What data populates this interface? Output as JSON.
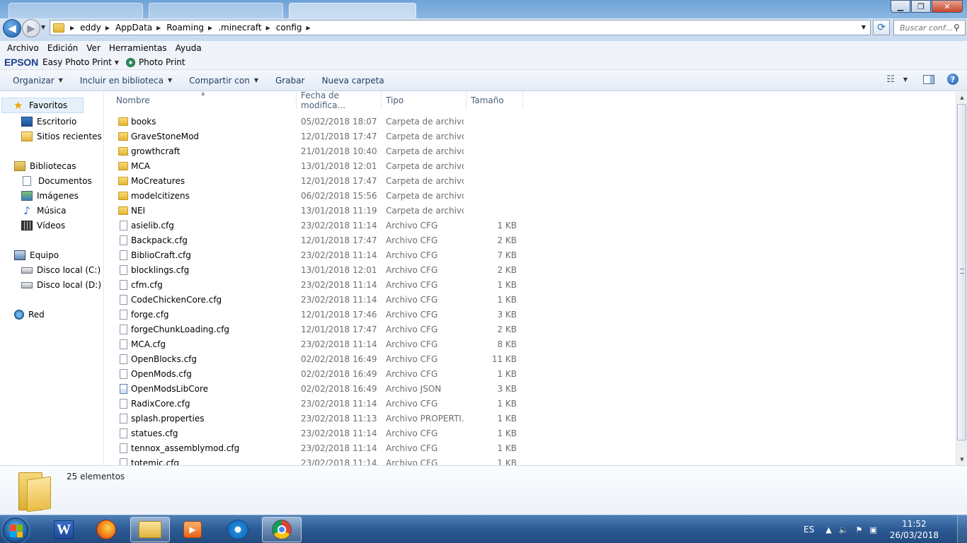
{
  "window": {
    "minimize_icon": "minimize-icon",
    "maximize_icon": "maximize-icon",
    "close_icon": "close-icon"
  },
  "address": {
    "breadcrumbs": [
      "eddy",
      "AppData",
      "Roaming",
      ".minecraft",
      "config"
    ],
    "search_placeholder": "Buscar conf..."
  },
  "menu": [
    "Archivo",
    "Edición",
    "Ver",
    "Herramientas",
    "Ayuda"
  ],
  "epson": {
    "logo": "EPSON",
    "easy_photo_print": "Easy Photo Print",
    "photo_print": "Photo Print"
  },
  "commands": {
    "organize": "Organizar",
    "include_library": "Incluir en biblioteca",
    "share_with": "Compartir con",
    "burn": "Grabar",
    "new_folder": "Nueva carpeta"
  },
  "nav": {
    "favorites": "Favoritos",
    "desktop": "Escritorio",
    "recent": "Sitios recientes",
    "libraries": "Bibliotecas",
    "documents": "Documentos",
    "images": "Imágenes",
    "music": "Música",
    "videos": "Vídeos",
    "computer": "Equipo",
    "drive_c": "Disco local (C:)",
    "drive_d": "Disco local (D:)",
    "network": "Red"
  },
  "columns": {
    "name": "Nombre",
    "date": "Fecha de modifica...",
    "type": "Tipo",
    "size": "Tamaño"
  },
  "files": [
    {
      "name": "books",
      "date": "05/02/2018 18:07",
      "type": "Carpeta de archivos",
      "size": "",
      "kind": "folder"
    },
    {
      "name": "GraveStoneMod",
      "date": "12/01/2018 17:47",
      "type": "Carpeta de archivos",
      "size": "",
      "kind": "folder"
    },
    {
      "name": "growthcraft",
      "date": "21/01/2018 10:40",
      "type": "Carpeta de archivos",
      "size": "",
      "kind": "folder"
    },
    {
      "name": "MCA",
      "date": "13/01/2018 12:01",
      "type": "Carpeta de archivos",
      "size": "",
      "kind": "folder"
    },
    {
      "name": "MoCreatures",
      "date": "12/01/2018 17:47",
      "type": "Carpeta de archivos",
      "size": "",
      "kind": "folder"
    },
    {
      "name": "modelcitizens",
      "date": "06/02/2018 15:56",
      "type": "Carpeta de archivos",
      "size": "",
      "kind": "folder"
    },
    {
      "name": "NEI",
      "date": "13/01/2018 11:19",
      "type": "Carpeta de archivos",
      "size": "",
      "kind": "folder"
    },
    {
      "name": "asielib.cfg",
      "date": "23/02/2018 11:14",
      "type": "Archivo CFG",
      "size": "1 KB",
      "kind": "file"
    },
    {
      "name": "Backpack.cfg",
      "date": "12/01/2018 17:47",
      "type": "Archivo CFG",
      "size": "2 KB",
      "kind": "file"
    },
    {
      "name": "BiblioCraft.cfg",
      "date": "23/02/2018 11:14",
      "type": "Archivo CFG",
      "size": "7 KB",
      "kind": "file"
    },
    {
      "name": "blocklings.cfg",
      "date": "13/01/2018 12:01",
      "type": "Archivo CFG",
      "size": "2 KB",
      "kind": "file"
    },
    {
      "name": "cfm.cfg",
      "date": "23/02/2018 11:14",
      "type": "Archivo CFG",
      "size": "1 KB",
      "kind": "file"
    },
    {
      "name": "CodeChickenCore.cfg",
      "date": "23/02/2018 11:14",
      "type": "Archivo CFG",
      "size": "1 KB",
      "kind": "file"
    },
    {
      "name": "forge.cfg",
      "date": "12/01/2018 17:46",
      "type": "Archivo CFG",
      "size": "3 KB",
      "kind": "file"
    },
    {
      "name": "forgeChunkLoading.cfg",
      "date": "12/01/2018 17:47",
      "type": "Archivo CFG",
      "size": "2 KB",
      "kind": "file"
    },
    {
      "name": "MCA.cfg",
      "date": "23/02/2018 11:14",
      "type": "Archivo CFG",
      "size": "8 KB",
      "kind": "file"
    },
    {
      "name": "OpenBlocks.cfg",
      "date": "02/02/2018 16:49",
      "type": "Archivo CFG",
      "size": "11 KB",
      "kind": "file"
    },
    {
      "name": "OpenMods.cfg",
      "date": "02/02/2018 16:49",
      "type": "Archivo CFG",
      "size": "1 KB",
      "kind": "file"
    },
    {
      "name": "OpenModsLibCore",
      "date": "02/02/2018 16:49",
      "type": "Archivo JSON",
      "size": "3 KB",
      "kind": "json"
    },
    {
      "name": "RadixCore.cfg",
      "date": "23/02/2018 11:14",
      "type": "Archivo CFG",
      "size": "1 KB",
      "kind": "file"
    },
    {
      "name": "splash.properties",
      "date": "23/02/2018 11:13",
      "type": "Archivo PROPERTI...",
      "size": "1 KB",
      "kind": "file"
    },
    {
      "name": "statues.cfg",
      "date": "23/02/2018 11:14",
      "type": "Archivo CFG",
      "size": "1 KB",
      "kind": "file"
    },
    {
      "name": "tennox_assemblymod.cfg",
      "date": "23/02/2018 11:14",
      "type": "Archivo CFG",
      "size": "1 KB",
      "kind": "file"
    },
    {
      "name": "totemic.cfg",
      "date": "23/02/2018 11:14",
      "type": "Archivo CFG",
      "size": "1 KB",
      "kind": "file"
    }
  ],
  "status": {
    "item_count": "25 elementos"
  },
  "taskbar": {
    "language": "ES",
    "time": "11:52",
    "date": "26/03/2018"
  }
}
